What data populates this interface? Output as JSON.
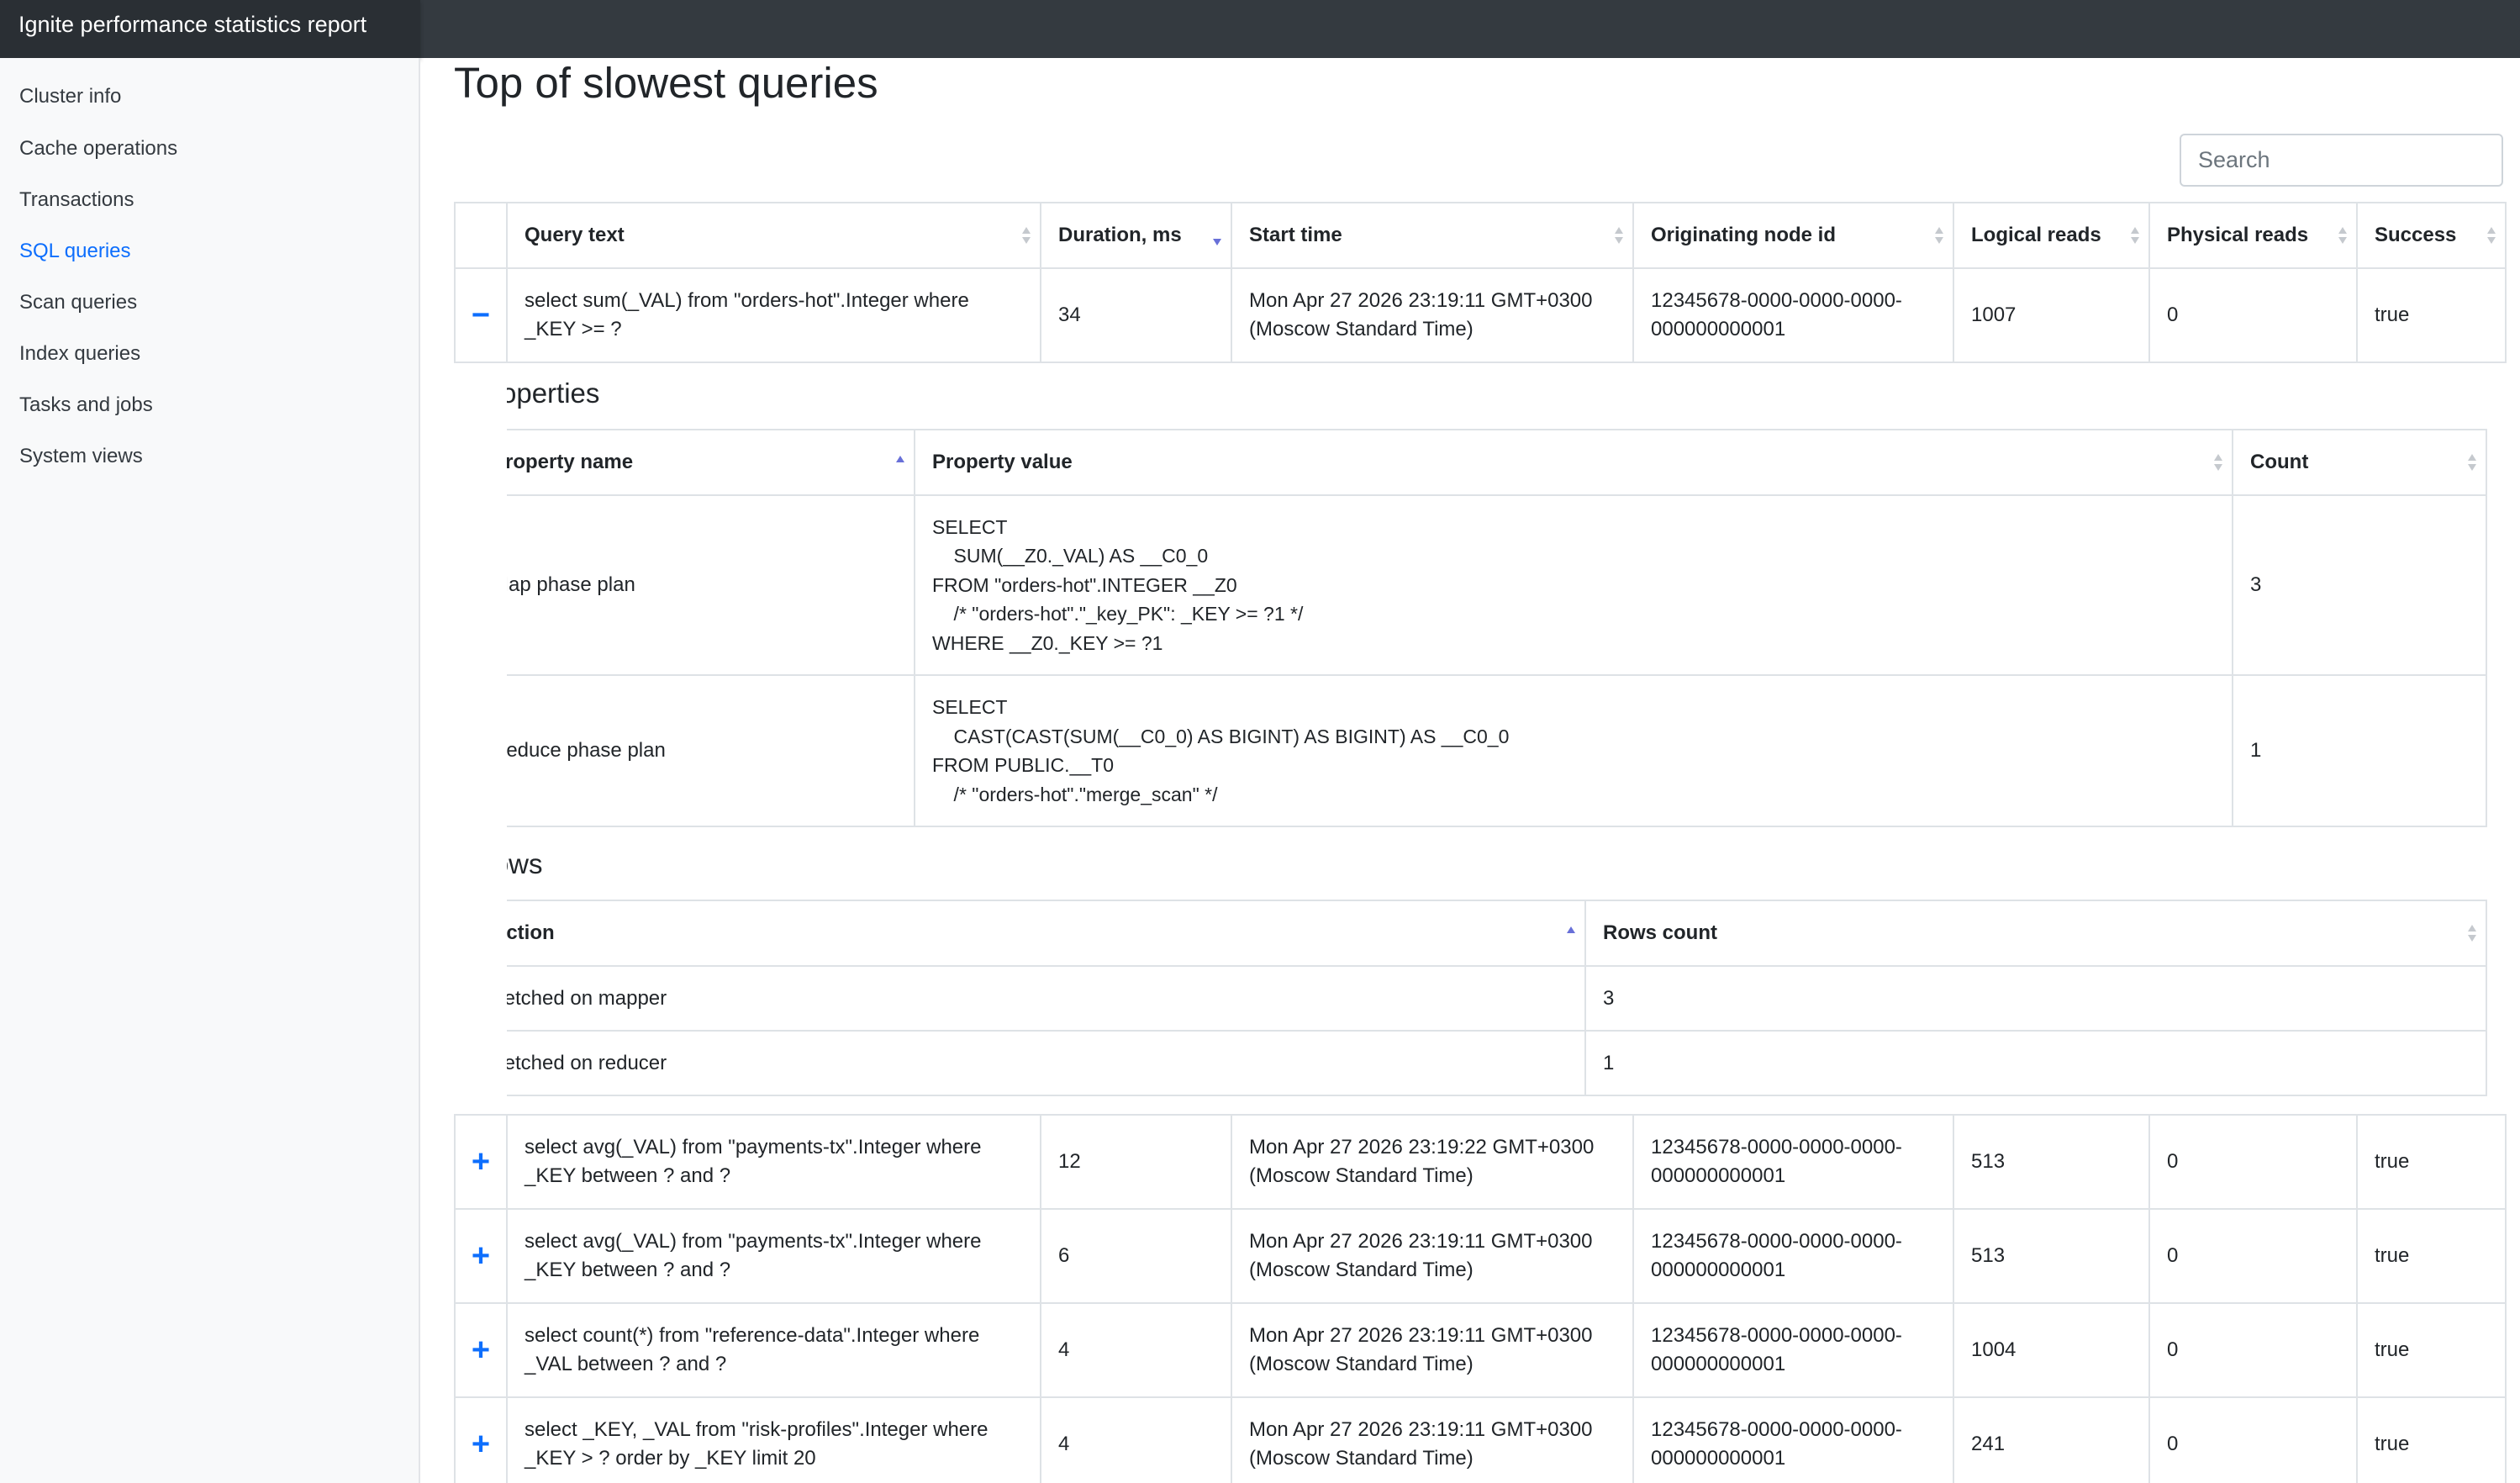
{
  "app": {
    "title": "Ignite performance statistics report"
  },
  "sidebar": {
    "items": [
      {
        "label": "Cluster info",
        "active": false
      },
      {
        "label": "Cache operations",
        "active": false
      },
      {
        "label": "Transactions",
        "active": false
      },
      {
        "label": "SQL queries",
        "active": true
      },
      {
        "label": "Scan queries",
        "active": false
      },
      {
        "label": "Index queries",
        "active": false
      },
      {
        "label": "Tasks and jobs",
        "active": false
      },
      {
        "label": "System views",
        "active": false
      }
    ]
  },
  "page": {
    "title": "Top of slowest queries",
    "search_placeholder": "Search"
  },
  "queries_table": {
    "columns": [
      "Query text",
      "Duration, ms",
      "Start time",
      "Originating node id",
      "Logical reads",
      "Physical reads",
      "Success"
    ],
    "sorted_column": "Duration, ms",
    "sort_direction": "descending",
    "rows": [
      {
        "expander": "−",
        "expanded": true,
        "query": "select sum(_VAL) from \"orders-hot\".Integer where _KEY >= ?",
        "duration": "34",
        "start_time": "Mon Apr 27 2026 23:19:11 GMT+0300 (Moscow Standard Time)",
        "node_id": "12345678-0000-0000-0000-000000000001",
        "logical_reads": "1007",
        "physical_reads": "0",
        "success": "true"
      },
      {
        "expander": "+",
        "expanded": false,
        "query": "select avg(_VAL) from \"payments-tx\".Integer where _KEY between ? and ?",
        "duration": "12",
        "start_time": "Mon Apr 27 2026 23:19:22 GMT+0300 (Moscow Standard Time)",
        "node_id": "12345678-0000-0000-0000-000000000001",
        "logical_reads": "513",
        "physical_reads": "0",
        "success": "true"
      },
      {
        "expander": "+",
        "expanded": false,
        "query": "select avg(_VAL) from \"payments-tx\".Integer where _KEY between ? and ?",
        "duration": "6",
        "start_time": "Mon Apr 27 2026 23:19:11 GMT+0300 (Moscow Standard Time)",
        "node_id": "12345678-0000-0000-0000-000000000001",
        "logical_reads": "513",
        "physical_reads": "0",
        "success": "true"
      },
      {
        "expander": "+",
        "expanded": false,
        "query": "select count(*) from \"reference-data\".Integer where _VAL between ? and ?",
        "duration": "4",
        "start_time": "Mon Apr 27 2026 23:19:11 GMT+0300 (Moscow Standard Time)",
        "node_id": "12345678-0000-0000-0000-000000000001",
        "logical_reads": "1004",
        "physical_reads": "0",
        "success": "true"
      },
      {
        "expander": "+",
        "expanded": false,
        "query": "select _KEY, _VAL from \"risk-profiles\".Integer where _KEY > ? order by _KEY limit 20",
        "duration": "4",
        "start_time": "Mon Apr 27 2026 23:19:11 GMT+0300 (Moscow Standard Time)",
        "node_id": "12345678-0000-0000-0000-000000000001",
        "logical_reads": "241",
        "physical_reads": "0",
        "success": "true"
      }
    ]
  },
  "detail": {
    "properties_heading": "Properties",
    "properties_columns": [
      "Property name",
      "Property value",
      "Count"
    ],
    "properties": [
      {
        "name": "Map phase plan",
        "value": "SELECT\n    SUM(__Z0._VAL) AS __C0_0\nFROM \"orders-hot\".INTEGER __Z0\n    /* \"orders-hot\".\"_key_PK\": _KEY >= ?1 */\nWHERE __Z0._KEY >= ?1",
        "count": "3"
      },
      {
        "name": "Reduce phase plan",
        "value": "SELECT\n    CAST(CAST(SUM(__C0_0) AS BIGINT) AS BIGINT) AS __C0_0\nFROM PUBLIC.__T0\n    /* \"orders-hot\".\"merge_scan\" */",
        "count": "1"
      }
    ],
    "rows_heading": "Rows",
    "rows_columns": [
      "Action",
      "Rows count"
    ],
    "rows": [
      {
        "action": "Fetched on mapper",
        "count": "3"
      },
      {
        "action": "Fetched on reducer",
        "count": "1"
      }
    ]
  }
}
